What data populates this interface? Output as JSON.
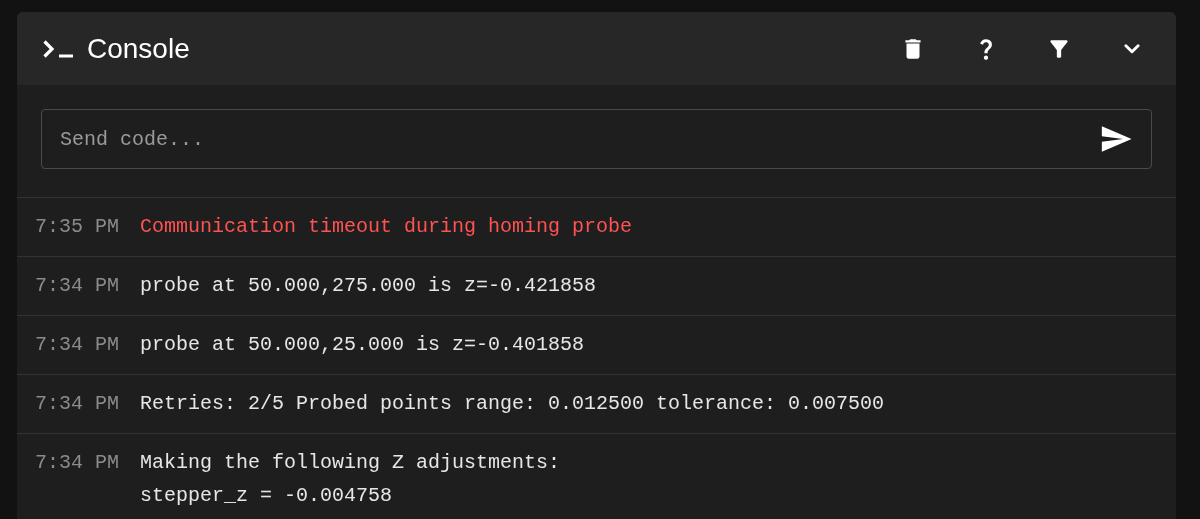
{
  "panel": {
    "title": "Console"
  },
  "input": {
    "placeholder": "Send code..."
  },
  "entries": [
    {
      "time": "7:35 PM",
      "kind": "error",
      "lines": [
        "Communication timeout during homing probe"
      ]
    },
    {
      "time": "7:34 PM",
      "kind": "normal",
      "lines": [
        "probe at 50.000,275.000 is z=-0.421858"
      ]
    },
    {
      "time": "7:34 PM",
      "kind": "normal",
      "lines": [
        "probe at 50.000,25.000 is z=-0.401858"
      ]
    },
    {
      "time": "7:34 PM",
      "kind": "normal",
      "lines": [
        "Retries: 2/5 Probed points range: 0.012500 tolerance: 0.007500"
      ]
    },
    {
      "time": "7:34 PM",
      "kind": "normal",
      "lines": [
        "Making the following Z adjustments:",
        "stepper_z = -0.004758"
      ]
    }
  ]
}
